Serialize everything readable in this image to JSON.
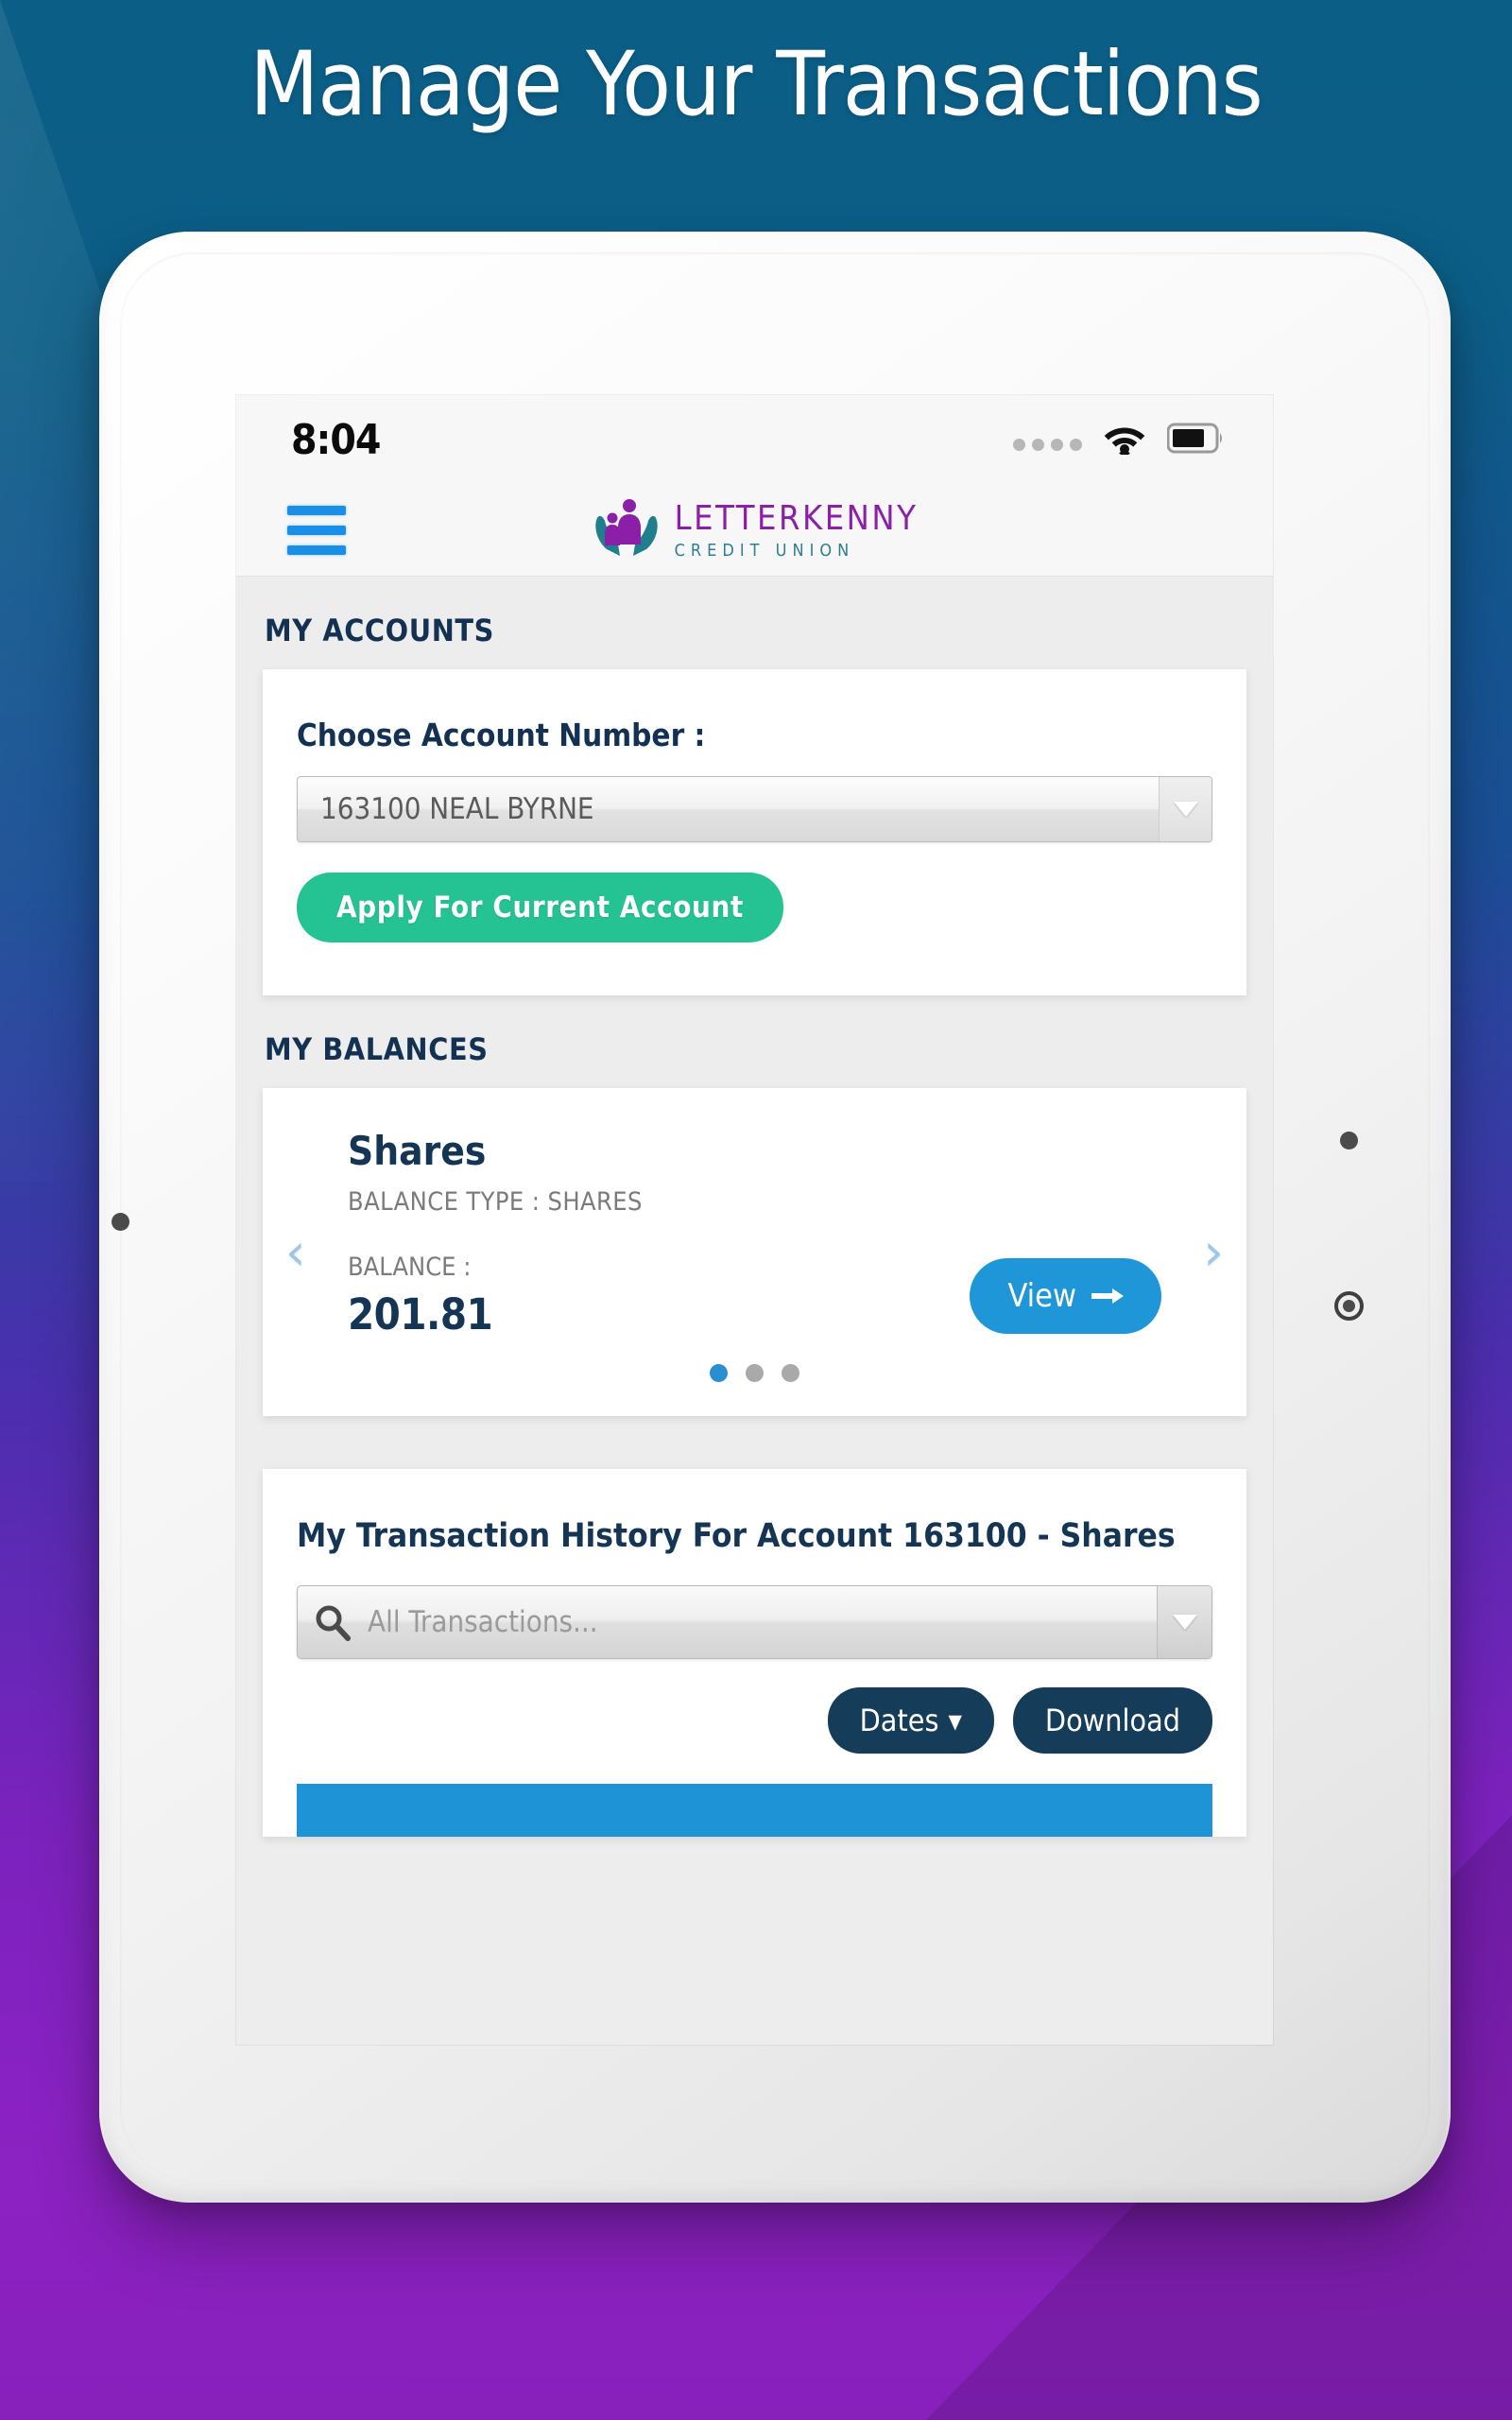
{
  "promo": {
    "headline": "Manage Your Transactions",
    "bg_top_color": "#0b5e86",
    "bg_bottom_color": "#8f22c6"
  },
  "status_bar": {
    "time": "8:04",
    "signal_icon": "signal-dots-icon",
    "wifi_icon": "wifi-icon",
    "battery_icon": "battery-icon",
    "battery_level": "75"
  },
  "header": {
    "menu_icon": "hamburger-menu-icon",
    "logo_icon": "letterkenny-logo-icon",
    "brand_name": "LETTERKENNY",
    "brand_sub": "CREDIT UNION",
    "brand_color": "#8b1fa8",
    "brand_sub_color": "#2e7e91",
    "menu_color": "#1a8fe8"
  },
  "accounts": {
    "section_label": "MY ACCOUNTS",
    "field_label": "Choose Account Number :",
    "selected_account": "163100 NEAL BYRNE",
    "dropdown_icon": "chevron-down-icon",
    "apply_button": "Apply For Current Account",
    "apply_button_color": "#25c294"
  },
  "balances": {
    "section_label": "MY BALANCES",
    "prev_icon": "chevron-left-icon",
    "next_icon": "chevron-right-icon",
    "card": {
      "title": "Shares",
      "type_label": "BALANCE TYPE : SHARES",
      "balance_label": "BALANCE :",
      "balance_value": "201.81",
      "view_button": "View",
      "view_button_icon": "arrow-right-icon",
      "view_button_color": "#1f96d8"
    },
    "pagination": {
      "total": 3,
      "active_index": 0,
      "active_color": "#2a8fd0",
      "inactive_color": "#a9a9a9"
    }
  },
  "transactions": {
    "title": "My Transaction History For Account 163100 - Shares",
    "search_icon": "search-icon",
    "search_placeholder": "All Transactions...",
    "search_dropdown_icon": "chevron-down-icon",
    "dates_button": "Dates",
    "dates_button_icon": "chevron-down-icon",
    "download_button": "Download",
    "button_color": "#153c59",
    "table_header_color": "#1e93d6"
  }
}
